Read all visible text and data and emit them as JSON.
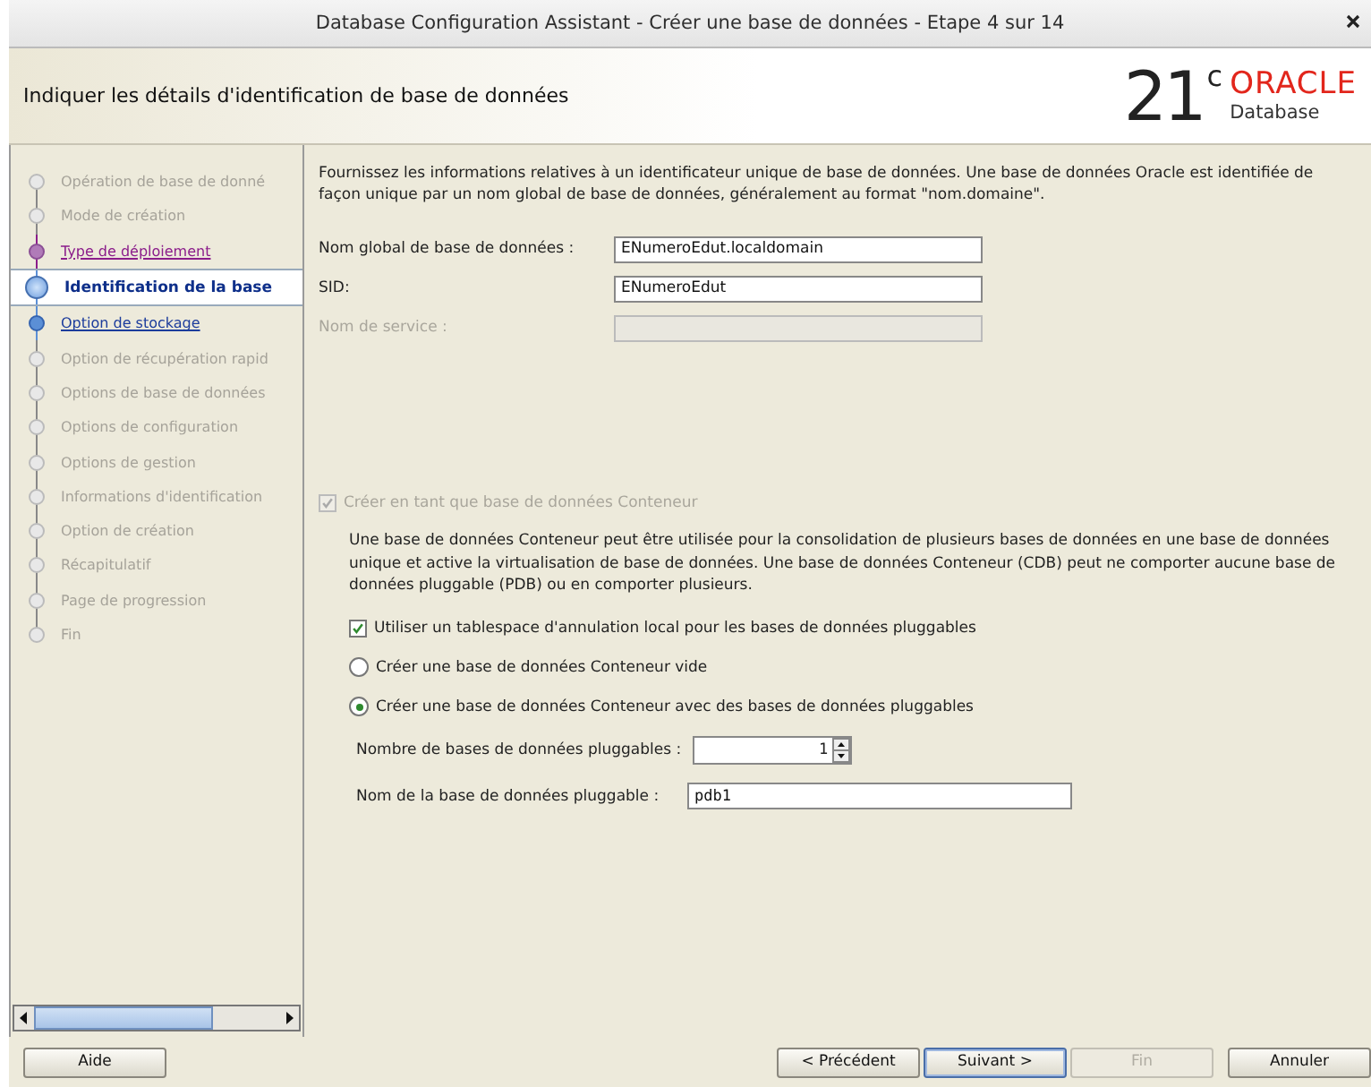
{
  "window": {
    "title": "Database Configuration Assistant - Créer une base de données - Etape 4 sur 14"
  },
  "header": {
    "title": "Indiquer les détails d'identification de base de données",
    "logo_version": "21",
    "logo_sup": "c",
    "logo_brand": "ORACLE",
    "logo_product": "Database"
  },
  "steps": [
    {
      "label": "Opération de base de donné",
      "enabled": false,
      "visited": false,
      "selected": false
    },
    {
      "label": "Mode de création",
      "enabled": false,
      "visited": false,
      "selected": false
    },
    {
      "label": "Type de déploiement",
      "enabled": true,
      "visited": true,
      "selected": false
    },
    {
      "label": "Identification de la base",
      "enabled": true,
      "visited": false,
      "selected": true
    },
    {
      "label": "Option de stockage",
      "enabled": true,
      "visited": false,
      "selected": false
    },
    {
      "label": "Option de récupération rapid",
      "enabled": false,
      "visited": false,
      "selected": false
    },
    {
      "label": "Options de base de données",
      "enabled": false,
      "visited": false,
      "selected": false
    },
    {
      "label": "Options de configuration",
      "enabled": false,
      "visited": false,
      "selected": false
    },
    {
      "label": "Options de gestion",
      "enabled": false,
      "visited": false,
      "selected": false
    },
    {
      "label": "Informations d'identification",
      "enabled": false,
      "visited": false,
      "selected": false
    },
    {
      "label": "Option de création",
      "enabled": false,
      "visited": false,
      "selected": false
    },
    {
      "label": "Récapitulatif",
      "enabled": false,
      "visited": false,
      "selected": false
    },
    {
      "label": "Page de progression",
      "enabled": false,
      "visited": false,
      "selected": false
    },
    {
      "label": "Fin",
      "enabled": false,
      "visited": false,
      "selected": false
    }
  ],
  "description": "Fournissez les informations relatives à un identificateur unique de base de données. Une base de données Oracle est identifiée de façon unique par un nom global de base de données, généralement au format \"nom.domaine\".",
  "fields": [
    {
      "label": "Nom global de base de données :",
      "value": "ENumeroEdut.localdomain",
      "disabled": false
    },
    {
      "label": "SID:",
      "value": "ENumeroEdut",
      "disabled": false
    },
    {
      "label": "Nom de service :",
      "disabled": true
    }
  ],
  "container": {
    "label": "Créer en tant que base de données Conteneur",
    "checked": true,
    "disabled": true,
    "description": "Une base de données Conteneur peut être utilisée pour la consolidation de plusieurs bases de données en une base de données unique et active la virtualisation de base de données. Une base de données Conteneur (CDB) peut ne comporter aucune base de données pluggable (PDB) ou en comporter plusieurs.",
    "options": [
      {
        "kind": "checkbox",
        "label": "Utiliser un tablespace d'annulation local pour les bases de données pluggables",
        "checked": true
      },
      {
        "kind": "radio",
        "label": "Créer une base de données Conteneur vide",
        "selected": false
      },
      {
        "kind": "radio",
        "label": "Créer une base de données Conteneur avec des bases de données pluggables",
        "selected": true
      }
    ],
    "pdb_count": {
      "label": "Nombre de bases de données pluggables :",
      "value": "1"
    },
    "pdb_name": {
      "label": "Nom de la base de données pluggable :",
      "value": "pdb1"
    }
  },
  "buttons": [
    {
      "label": "Aide",
      "disabled": false,
      "default": false
    },
    {
      "label": "< Précédent",
      "disabled": false,
      "default": false
    },
    {
      "label": "Suivant >",
      "disabled": false,
      "default": true
    },
    {
      "label": "Fin",
      "disabled": true,
      "default": false
    },
    {
      "label": "Annuler",
      "disabled": false,
      "default": false
    }
  ]
}
